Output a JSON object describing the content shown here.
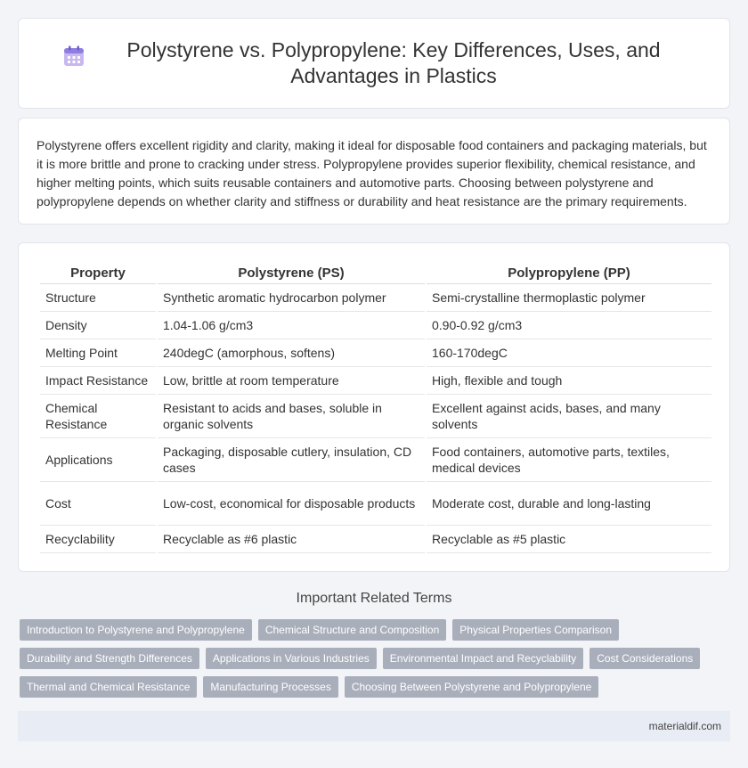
{
  "header": {
    "title": "Polystyrene vs. Polypropylene: Key Differences, Uses, and Advantages in Plastics",
    "icon": "calendar-icon"
  },
  "intro": "Polystyrene offers excellent rigidity and clarity, making it ideal for disposable food containers and packaging materials, but it is more brittle and prone to cracking under stress. Polypropylene provides superior flexibility, chemical resistance, and higher melting points, which suits reusable containers and automotive parts. Choosing between polystyrene and polypropylene depends on whether clarity and stiffness or durability and heat resistance are the primary requirements.",
  "table": {
    "headers": [
      "Property",
      "Polystyrene (PS)",
      "Polypropylene (PP)"
    ],
    "rows": [
      [
        "Structure",
        "Synthetic aromatic hydrocarbon polymer",
        "Semi-crystalline thermoplastic polymer"
      ],
      [
        "Density",
        "1.04-1.06 g/cm3",
        "0.90-0.92 g/cm3"
      ],
      [
        "Melting Point",
        "240degC (amorphous, softens)",
        "160-170degC"
      ],
      [
        "Impact Resistance",
        "Low, brittle at room temperature",
        "High, flexible and tough"
      ],
      [
        "Chemical Resistance",
        "Resistant to acids and bases, soluble in organic solvents",
        "Excellent against acids, bases, and many solvents"
      ],
      [
        "Applications",
        "Packaging, disposable cutlery, insulation, CD cases",
        "Food containers, automotive parts, textiles, medical devices"
      ],
      [
        "Cost",
        "Low-cost, economical for disposable products",
        "Moderate cost, durable and long-lasting"
      ],
      [
        "Recyclability",
        "Recyclable as #6 plastic",
        "Recyclable as #5 plastic"
      ]
    ]
  },
  "related": {
    "title": "Important Related Terms",
    "tags": [
      [
        "Introduction to Polystyrene and Polypropylene",
        "Chemical Structure and Composition",
        "Physical Properties Comparison"
      ],
      [
        "Durability and Strength Differences",
        "Applications in Various Industries",
        "Environmental Impact and Recyclability",
        "Cost Considerations"
      ],
      [
        "Thermal and Chemical Resistance",
        "Manufacturing Processes",
        "Choosing Between Polystyrene and Polypropylene"
      ]
    ]
  },
  "footer": {
    "site": "materialdif.com"
  },
  "colors": {
    "tag_bg": "#a9aebb",
    "footer_bg": "#e8ecf4",
    "page_bg": "#f3f4f7"
  }
}
